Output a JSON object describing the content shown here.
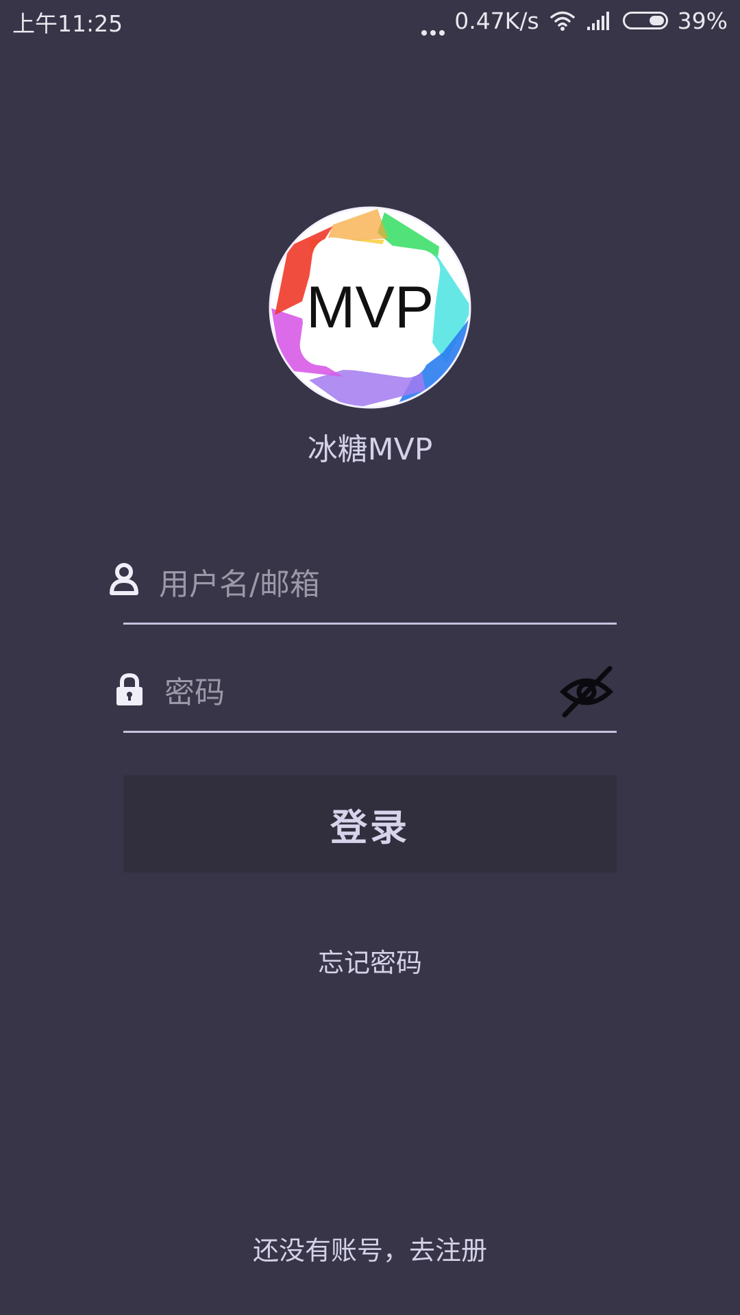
{
  "status_bar": {
    "time": "上午11:25",
    "network_speed": "0.47K/s",
    "battery_percent": "39%",
    "battery_level": 0.39,
    "icons": [
      "more-dots-icon",
      "wifi-icon",
      "signal-icon",
      "battery-icon"
    ]
  },
  "logo": {
    "text": "MVP",
    "icon": "mvp-logo-icon"
  },
  "app_name": "冰糖MVP",
  "login_form": {
    "username": {
      "value": "",
      "placeholder": "用户名/邮箱",
      "icon": "user-icon"
    },
    "password": {
      "value": "",
      "placeholder": "密码",
      "icon": "lock-icon",
      "toggle_icon": "eye-off-icon"
    },
    "login_label": "登录",
    "forgot_password_label": "忘记密码",
    "register_label": "还没有账号，去注册"
  },
  "colors": {
    "background": "#383548",
    "button_background": "#312e3e",
    "underline": "#c6c3e0",
    "text": "#d4d2e8"
  }
}
